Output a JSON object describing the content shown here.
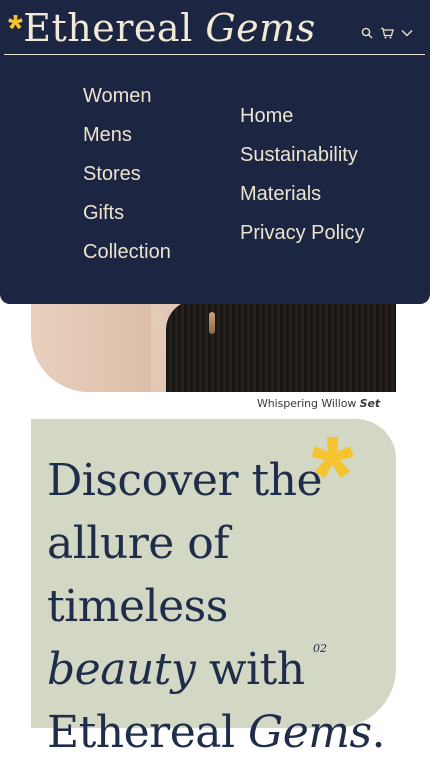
{
  "brand": {
    "asterisk": "*",
    "name": "Ethereal",
    "name_italic": "Gems"
  },
  "header": {
    "icons": [
      "search-icon",
      "cart-icon",
      "chevron-down-icon"
    ]
  },
  "menu": {
    "left": [
      {
        "label": "Women"
      },
      {
        "label": "Mens"
      },
      {
        "label": "Stores"
      },
      {
        "label": "Gifts"
      },
      {
        "label": "Collection"
      }
    ],
    "right": [
      {
        "label": "Home"
      },
      {
        "label": "Sustainability"
      },
      {
        "label": "Materials"
      },
      {
        "label": "Privacy Policy"
      }
    ]
  },
  "hero": {
    "caption_name": "Whispering Willow",
    "caption_italic": "Set"
  },
  "discover": {
    "line1": "Discover the",
    "line2": "allure of timeless",
    "line3_italic": "beauty",
    "line3": " with",
    "line4": "Ethereal ",
    "line4_italic": "Gems",
    "line4_end": ".",
    "asterisk": "*",
    "index": "02"
  },
  "colors": {
    "navy": "#1c2541",
    "accent": "#f4c531",
    "sage": "#d2d8c4",
    "cream": "#ece4cf"
  }
}
